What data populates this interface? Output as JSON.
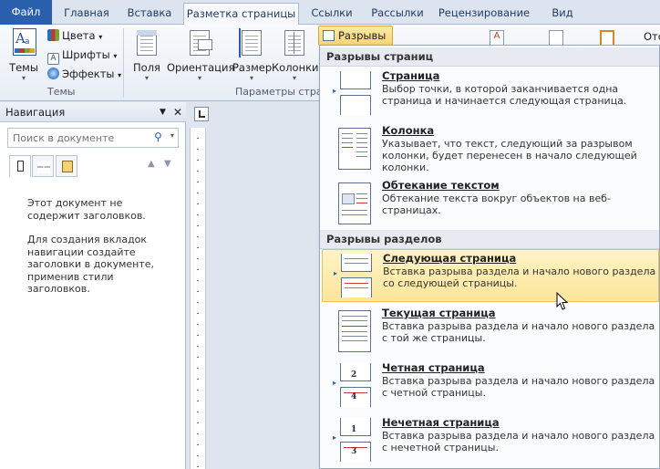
{
  "tabs": [
    "Файл",
    "Главная",
    "Вставка",
    "Разметка страницы",
    "Ссылки",
    "Рассылки",
    "Рецензирование",
    "Вид"
  ],
  "ribbon": {
    "themes": {
      "big_label": "Темы",
      "colors": "Цвета",
      "fonts": "Шрифты",
      "effects": "Эффекты",
      "group": "Темы"
    },
    "page_setup": {
      "margins": "Поля",
      "orientation": "Ориентация",
      "size": "Размер",
      "columns": "Колонки",
      "group": "Параметры стран"
    },
    "breaks_button": "Разрывы",
    "right_cut": "Отс"
  },
  "nav": {
    "title": "Навигация",
    "search_placeholder": "Поиск в документе",
    "message1": "Этот документ не содержит заголовков.",
    "message2": "Для создания вкладок навигации создайте заголовки в документе, применив стили заголовков."
  },
  "menu": {
    "page_breaks_header": "Разрывы страниц",
    "section_breaks_header": "Разрывы разделов",
    "page_breaks": [
      {
        "title": "Страница",
        "desc": "Выбор точки, в которой заканчивается одна страница и начинается следующая страница."
      },
      {
        "title": "Колонка",
        "desc": "Указывает, что текст, следующий за разрывом колонки, будет перенесен в начало следующей колонки."
      },
      {
        "title": "Обтекание текстом",
        "desc": "Обтекание текста вокруг объектов на веб-страницах."
      }
    ],
    "section_breaks": [
      {
        "title": "Следующая страница",
        "desc": "Вставка разрыва раздела и начало нового раздела со следующей страницы."
      },
      {
        "title": "Текущая страница",
        "desc": "Вставка разрыва раздела и начало нового раздела с той же страницы."
      },
      {
        "title": "Четная страница",
        "desc": "Вставка разрыва раздела и начало нового раздела с четной страницы."
      },
      {
        "title": "Нечетная страница",
        "desc": "Вставка разрыва раздела и начало нового раздела с нечетной страницы."
      }
    ],
    "even_digits": [
      "2",
      "4"
    ],
    "odd_digits": [
      "1",
      "3"
    ]
  },
  "colors": {
    "accent": "#2a5fae",
    "highlight": "#fde59a",
    "break_red": "#d23b2b"
  }
}
